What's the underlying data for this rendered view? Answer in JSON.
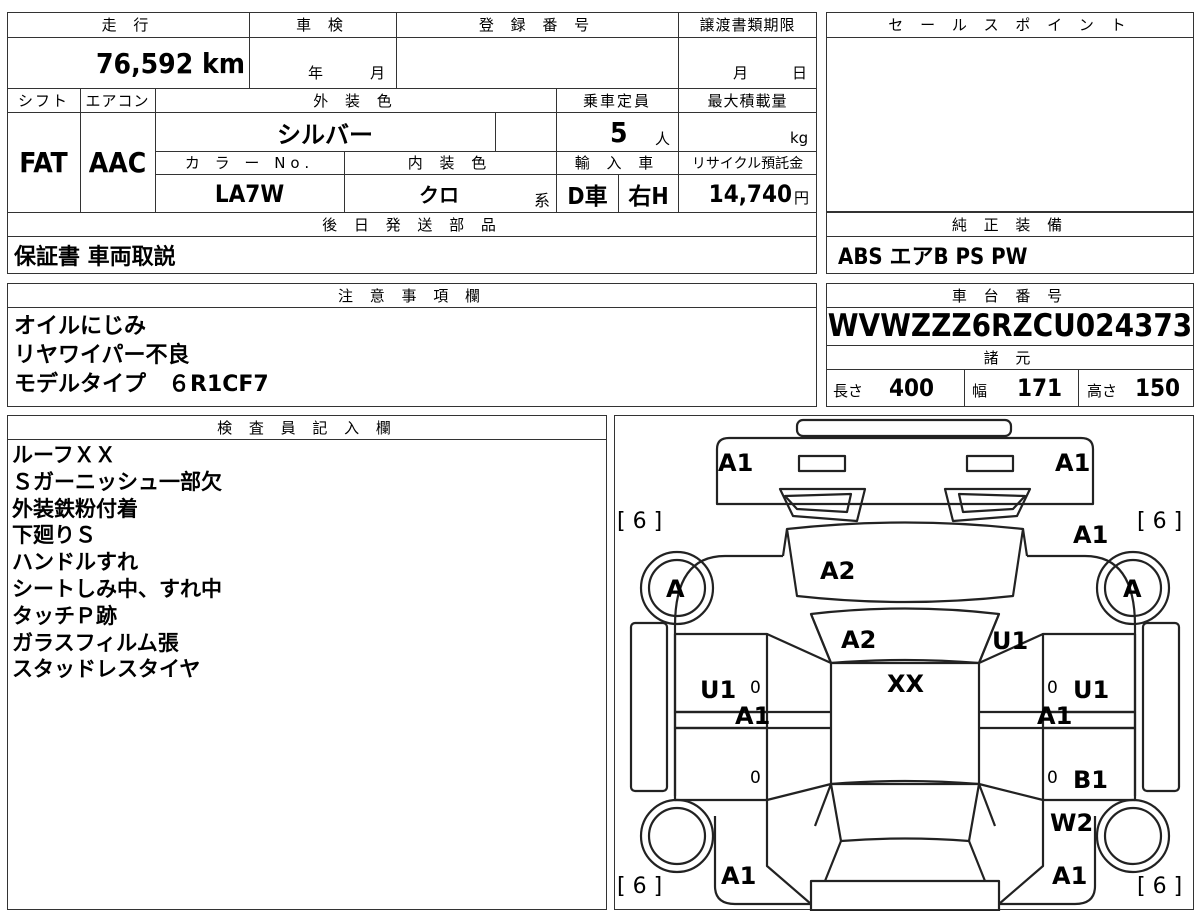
{
  "top": {
    "mileage_header": "走 行",
    "mileage_value": "76,592 km",
    "inspection_header": "車 検",
    "inspection_year": "年",
    "inspection_month": "月",
    "registration_header": "登 録 番 号",
    "transfer_header": "譲渡書類期限",
    "transfer_month": "月",
    "transfer_day": "日"
  },
  "row2": {
    "shift_header": "シフト",
    "ac_header": "エアコン",
    "exterior_color_header": "外 装 色",
    "capacity_header": "乗車定員",
    "max_load_header": "最大積載量",
    "shift_value": "FAT",
    "ac_value": "AAC",
    "exterior_color_value": "シルバー",
    "capacity_value": "5",
    "capacity_unit": "人",
    "max_load_unit": "kg",
    "color_no_header": "カ ラ ー No.",
    "interior_color_header": "内 装 色",
    "import_header": "輸 入 車",
    "recycle_header": "リサイクル預託金",
    "color_no_value": "LA7W",
    "interior_color_value": "クロ",
    "interior_suffix": "系",
    "import_value": "D車",
    "steering_value": "右H",
    "recycle_value": "14,740",
    "recycle_unit": "円"
  },
  "parts": {
    "header": "後 日 発 送 部 品",
    "value": "保証書 車両取説"
  },
  "sales_point": {
    "header": "セ ー ル ス ポ イ ン ト"
  },
  "equipment": {
    "header": "純 正 装 備",
    "value": "ABS エアB PS PW"
  },
  "notes": {
    "header": "注 意 事 項 欄",
    "lines": [
      "オイルにじみ",
      "リヤワイパー不良",
      "モデルタイプ　６R1CF7"
    ]
  },
  "chassis": {
    "header": "車 台 番 号",
    "value": "WVWZZZ6RZCU024373",
    "specs_header": "諸 元",
    "length_label": "長さ",
    "length_value": "400",
    "width_label": "幅",
    "width_value": "171",
    "height_label": "高さ",
    "height_value": "150"
  },
  "inspector": {
    "header": "検 査 員 記 入 欄",
    "lines": [
      "ルーフＸＸ",
      "Ｓガーニッシュ一部欠",
      "外装鉄粉付着",
      "下廻りＳ",
      "ハンドルすれ",
      "シートしみ中、すれ中",
      "タッチＰ跡",
      "ガラスフィルム張",
      "スタッドレスタイヤ"
    ]
  },
  "diagram": {
    "marks": {
      "front_left": "A1",
      "front_right": "A1",
      "hood": "A2",
      "windshield": "A2",
      "right_fender": "A1",
      "right_a_pillar": "U1",
      "roof": "XX",
      "left_front_door_u": "U1",
      "left_front_door_a": "A1",
      "right_front_door_u": "U1",
      "right_front_door_a": "A1",
      "right_rear_door": "B1",
      "right_rear_wheel": "W2",
      "rear_left": "A1",
      "rear_right": "A1",
      "left_front_wheel": "A",
      "right_front_wheel": "A"
    },
    "tire_labels": {
      "front_left": "[ 6 ]",
      "front_right": "[ 6 ]",
      "rear_left": "[ 6 ]",
      "rear_right": "[ 6 ]"
    },
    "zeros": [
      "0",
      "0",
      "0",
      "0"
    ]
  }
}
